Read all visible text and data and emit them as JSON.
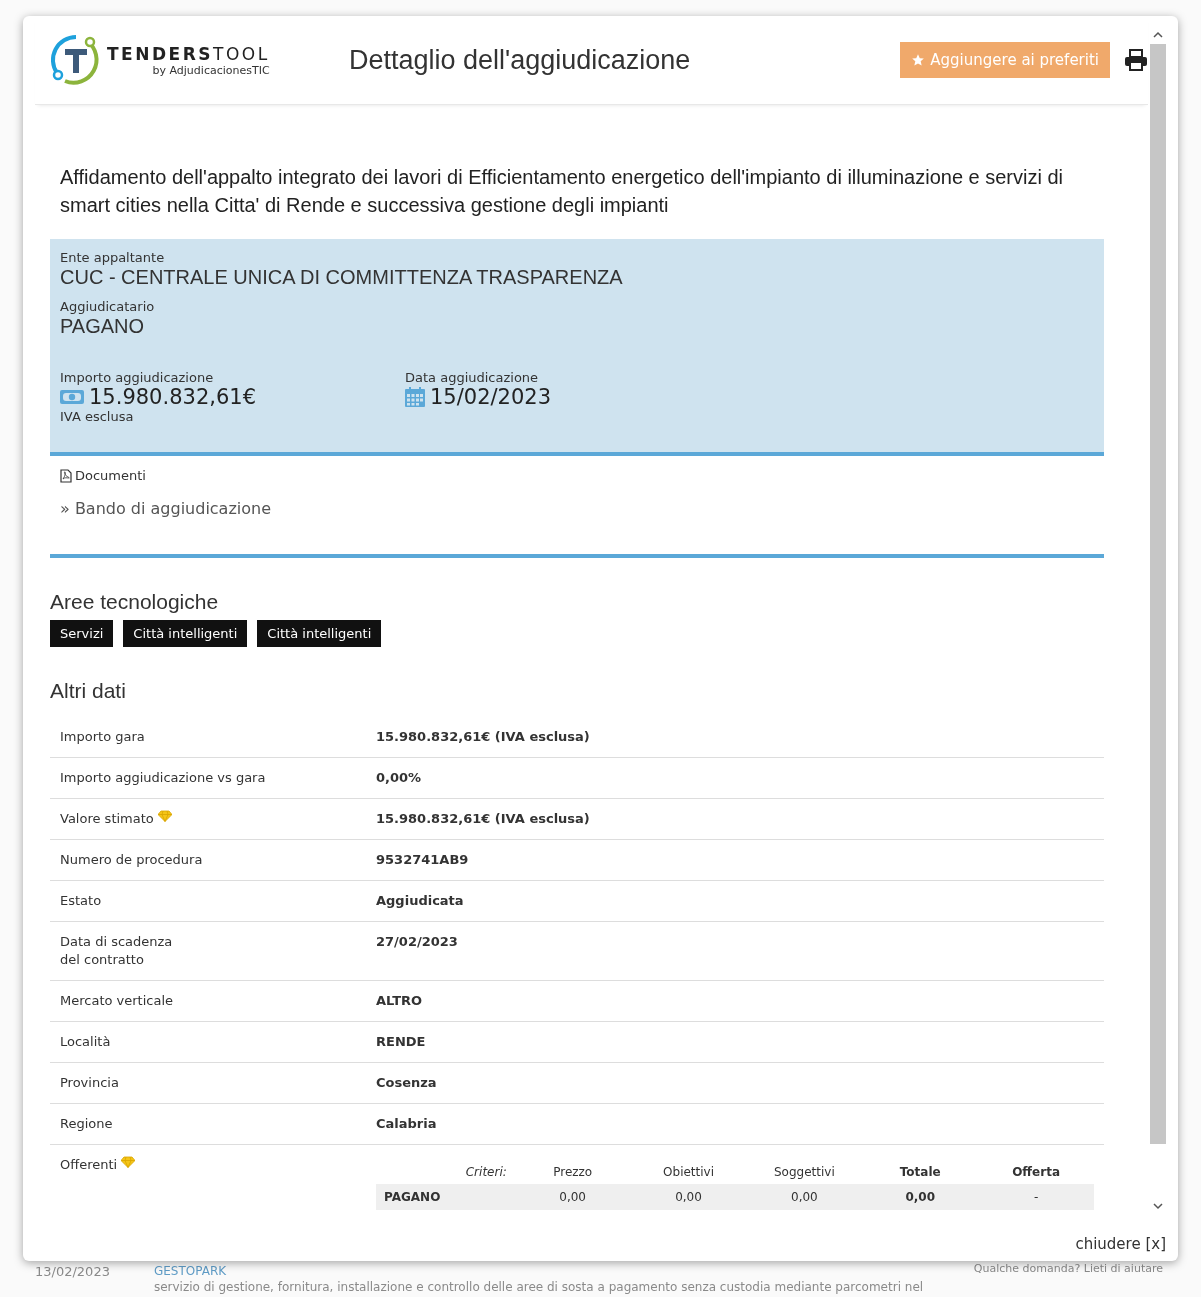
{
  "background": {
    "list_row": {
      "date": "13/02/2023",
      "company": "GESTOPARK",
      "description": "servizio di gestione, fornitura, installazione e controllo delle aree di sosta a pagamento senza custodia mediante parcometri nel"
    },
    "chat_prompt": "Qualche domanda? Lieti di aiutare"
  },
  "modal": {
    "logo": {
      "brand_bold": "TENDERS",
      "brand_light": "TOOL",
      "byline": "by AdjudicacionesTIC"
    },
    "title": "Dettaglio dell'aggiudicazione",
    "favorite_button": "Aggiungere ai preferiti",
    "heading": "Affidamento dell'appalto integrato dei lavori di Efficientamento energetico dell'impianto di illuminazione e servizi di smart cities nella Citta' di Rende e successiva gestione degli impianti",
    "summary": {
      "contracting_authority": {
        "label": "Ente appaltante",
        "value": "CUC - CENTRALE UNICA DI COMMITTENZA TRASPARENZA"
      },
      "awardee": {
        "label": "Aggiudicatario",
        "value": "PAGANO"
      },
      "amount": {
        "label": "Importo aggiudicazione",
        "value": "15.980.832,61€",
        "note": "IVA esclusa"
      },
      "date": {
        "label": "Data aggiudicazione",
        "value": "15/02/2023"
      }
    },
    "documents": {
      "label": "Documenti",
      "links": [
        "» Bando di aggiudicazione"
      ]
    },
    "tech_areas": {
      "heading": "Aree tecnologiche",
      "tags": [
        "Servizi",
        "Città intelligenti",
        "Città intelligenti"
      ]
    },
    "other_data": {
      "heading": "Altri dati",
      "rows": [
        {
          "kind": "text",
          "label": "Importo gara",
          "premium": false,
          "value": "15.980.832,61€ (IVA esclusa)"
        },
        {
          "kind": "text",
          "label": "Importo aggiudicazione vs gara",
          "premium": false,
          "value": "0,00%"
        },
        {
          "kind": "text",
          "label": "Valore stimato",
          "premium": true,
          "value": "15.980.832,61€ (IVA esclusa)"
        },
        {
          "kind": "text",
          "label": "Numero de procedura",
          "premium": false,
          "value": "9532741AB9"
        },
        {
          "kind": "text",
          "label": "Estato",
          "premium": false,
          "value": "Aggiudicata"
        },
        {
          "kind": "text",
          "label": "Data di scadenza\ndel contratto",
          "premium": false,
          "value": "27/02/2023"
        },
        {
          "kind": "text",
          "label": "Mercato verticale",
          "premium": false,
          "value": "ALTRO"
        },
        {
          "kind": "text",
          "label": "Località",
          "premium": false,
          "value": "RENDE"
        },
        {
          "kind": "text",
          "label": "Provincia",
          "premium": false,
          "value": "Cosenza"
        },
        {
          "kind": "text",
          "label": "Regione",
          "premium": false,
          "value": "Calabria"
        },
        {
          "kind": "bidders",
          "label": "Offerenti",
          "premium": true,
          "criteria_label": "Criteri:",
          "columns": [
            "Prezzo",
            "Obiettivi",
            "Soggettivi",
            "Totale",
            "Offerta"
          ],
          "bidders": [
            {
              "name": "PAGANO",
              "cells": [
                "0,00",
                "0,00",
                "0,00",
                "0,00",
                "-"
              ]
            }
          ]
        }
      ]
    },
    "close_link": "chiudere [x]"
  }
}
